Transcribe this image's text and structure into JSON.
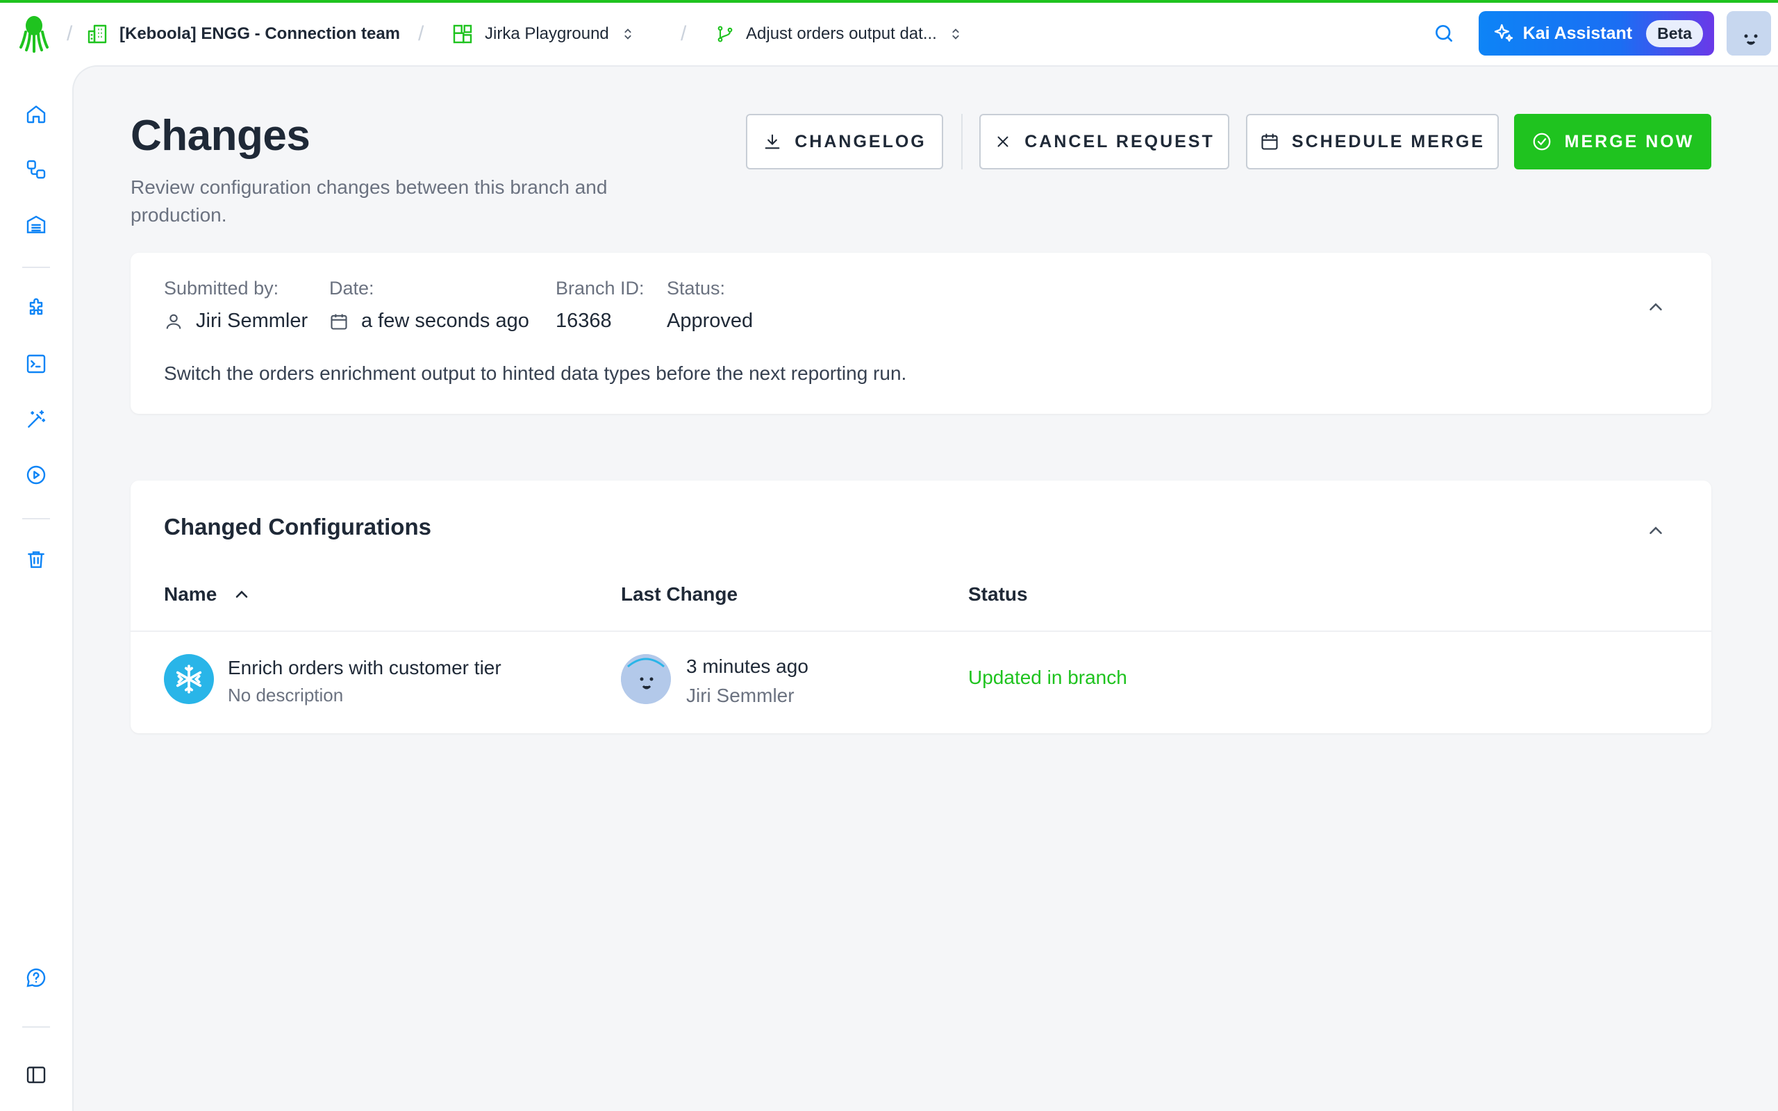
{
  "breadcrumb": {
    "organization": "[Keboola] ENGG - Connection team",
    "project": "Jirka Playground",
    "branch": "Adjust orders output dat..."
  },
  "topbar": {
    "assistant_label": "Kai Assistant",
    "assistant_badge": "Beta"
  },
  "page": {
    "title": "Changes",
    "subtitle": "Review configuration changes between this branch and production."
  },
  "actions": {
    "changelog": "CHANGELOG",
    "cancel_request": "CANCEL REQUEST",
    "schedule_merge": "SCHEDULE MERGE",
    "merge_now": "MERGE NOW"
  },
  "request": {
    "submitted_by_label": "Submitted by:",
    "submitted_by": "Jiri Semmler",
    "date_label": "Date:",
    "date": "a few seconds ago",
    "branch_id_label": "Branch ID:",
    "branch_id": "16368",
    "status_label": "Status:",
    "status": "Approved",
    "description": "Switch the orders enrichment output to hinted data types before the next reporting run."
  },
  "configurations": {
    "title": "Changed Configurations",
    "columns": {
      "name": "Name",
      "last_change": "Last Change",
      "status": "Status"
    },
    "rows": [
      {
        "name": "Enrich orders with customer tier",
        "description": "No description",
        "last_change_time": "3 minutes ago",
        "last_change_user": "Jiri Semmler",
        "status": "Updated in branch"
      }
    ]
  },
  "colors": {
    "accent_green": "#1fc31f",
    "kai_gradient_start": "#0d84f6",
    "kai_gradient_end": "#6a39e8",
    "snowflake_blue": "#29b5e8"
  }
}
